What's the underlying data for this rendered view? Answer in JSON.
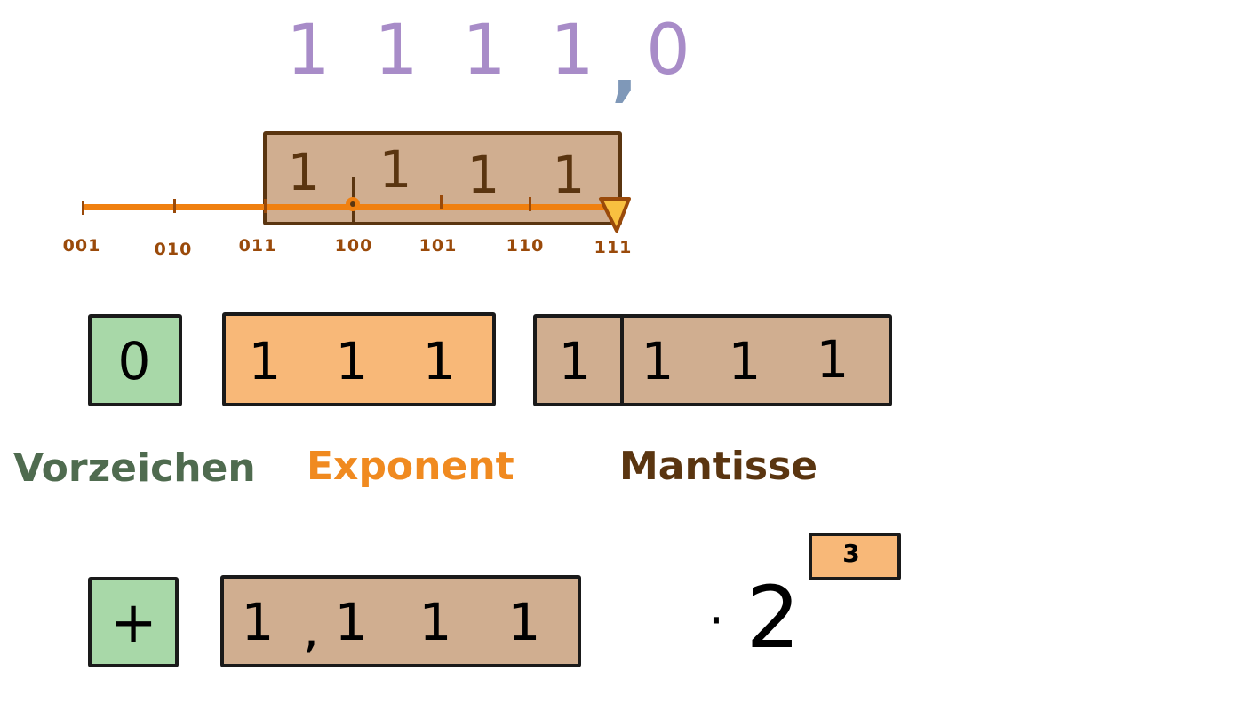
{
  "top_number": {
    "digits": [
      "1",
      "1",
      "1",
      "1"
    ],
    "comma": ",",
    "fraction": "0"
  },
  "scale": {
    "mantissa_digits": [
      "1",
      "1",
      "1",
      "1"
    ],
    "tick_labels": [
      "001",
      "010",
      "011",
      "100",
      "101",
      "110",
      "111"
    ],
    "marker_value": "111"
  },
  "encoding": {
    "sign": "0",
    "exponent": [
      "1",
      "1",
      "1"
    ],
    "mantissa_hidden": "1",
    "mantissa": [
      "1",
      "1",
      "1"
    ]
  },
  "labels": {
    "sign": "Vorzeichen",
    "exponent": "Exponent",
    "mantissa": "Mantisse"
  },
  "result": {
    "sign": "+",
    "mantissa": [
      "1",
      "1",
      "1",
      "1"
    ],
    "comma": ",",
    "dot": "·",
    "base": "2",
    "exponent": "3"
  },
  "colors": {
    "purple": "#a88cc8",
    "sign_green": "#a8d8a8",
    "exponent_orange": "#f8b878",
    "mantissa_tan": "#d0ae90",
    "line_orange": "#f08010",
    "brown": "#5a3510"
  }
}
